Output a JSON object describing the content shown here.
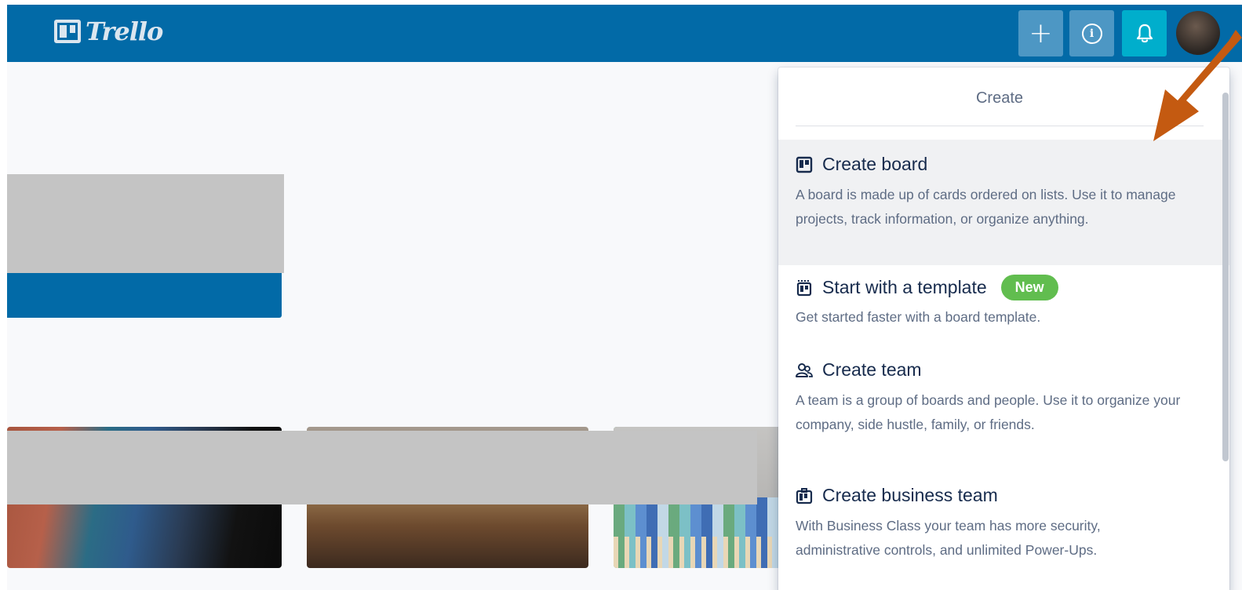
{
  "header": {
    "logo_text": "Trello",
    "buttons": [
      {
        "name": "plus-button",
        "icon": "plus-icon",
        "glyph": "+"
      },
      {
        "name": "info-button",
        "icon": "info-icon",
        "glyph": "i"
      },
      {
        "name": "notifications-button",
        "icon": "bell-icon"
      }
    ],
    "colors": {
      "bar": "#026aa7",
      "button": "#4d97c4",
      "bell_button": "#00aecc"
    }
  },
  "create_menu": {
    "title": "Create",
    "items": [
      {
        "icon": "board-icon",
        "label": "Create board",
        "description": "A board is made up of cards ordered on lists. Use it to manage projects, track information, or organize anything."
      },
      {
        "icon": "template-icon",
        "label": "Start with a template",
        "badge": "New",
        "description": "Get started faster with a board template."
      },
      {
        "icon": "team-icon",
        "label": "Create team",
        "description": "A team is a group of boards and people. Use it to organize your company, side hustle, family, or friends."
      },
      {
        "icon": "business-icon",
        "label": "Create business team",
        "description": "With Business Class your team has more security, administrative controls, and unlimited Power-Ups."
      }
    ],
    "colors": {
      "badge": "#61bd4f",
      "highlight": "#f0f1f3"
    }
  },
  "annotation": {
    "arrow_color": "#c45a11"
  }
}
